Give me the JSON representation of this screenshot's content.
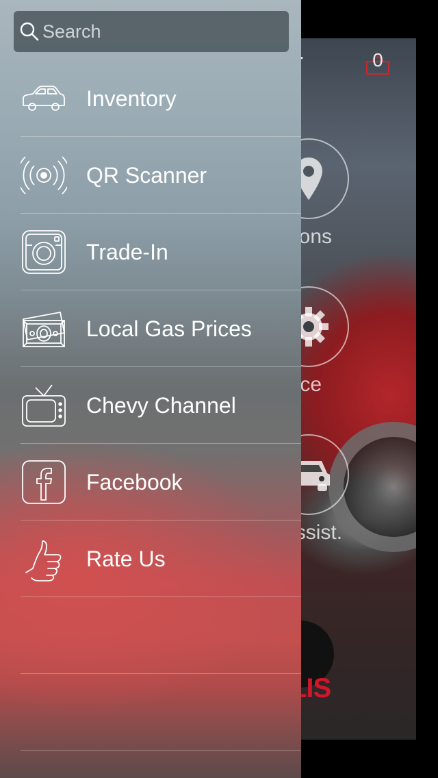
{
  "search": {
    "placeholder": "Search",
    "value": ""
  },
  "menu": {
    "items": [
      {
        "label": "Inventory",
        "icon": "car-icon"
      },
      {
        "label": "QR Scanner",
        "icon": "broadcast-icon"
      },
      {
        "label": "Trade-In",
        "icon": "camera-icon"
      },
      {
        "label": "Local Gas Prices",
        "icon": "money-icon"
      },
      {
        "label": "Chevy Channel",
        "icon": "tv-icon"
      },
      {
        "label": "Facebook",
        "icon": "facebook-icon"
      },
      {
        "label": "Rate Us",
        "icon": "thumbs-up-icon"
      }
    ]
  },
  "background_app": {
    "title_fragment": "t",
    "cart_count": "0",
    "buttons": [
      {
        "label": "ections",
        "icon": "map-pin-icon"
      },
      {
        "label": "ervice",
        "icon": "gear-icon"
      },
      {
        "label": "k Assist.",
        "icon": "car-icon"
      }
    ],
    "brand_fragment": "LIS"
  },
  "colors": {
    "brand_red": "#d0162b",
    "drawer_top": "#a9b6bd",
    "drawer_bottom_accent": "#c3504f"
  }
}
